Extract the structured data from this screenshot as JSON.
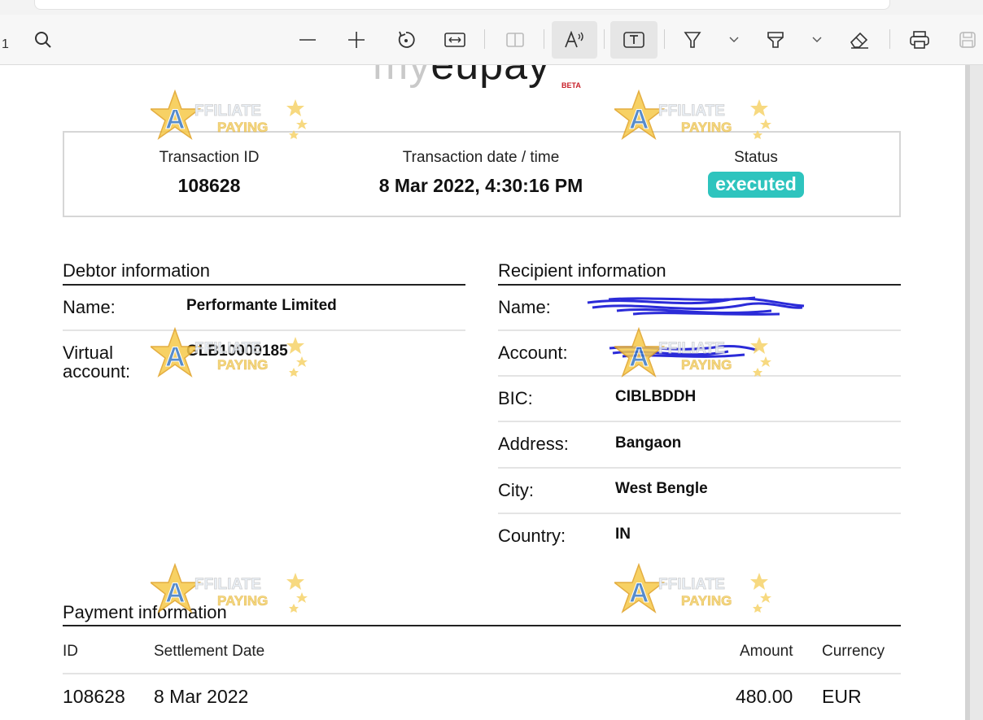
{
  "toolbar": {
    "page_number": "1",
    "icons": [
      "search-icon",
      "zoom-out-icon",
      "zoom-in-icon",
      "rotate-icon",
      "fit-width-icon",
      "two-page-icon",
      "read-aloud-icon",
      "text-box-icon",
      "draw-icon",
      "chevron-down-icon",
      "highlight-icon",
      "chevron-down-icon",
      "eraser-icon",
      "print-icon",
      "save-icon"
    ]
  },
  "logo": {
    "text_faded": "my",
    "text_main": "eupay",
    "beta": "BETA"
  },
  "summary": {
    "transaction_id_label": "Transaction ID",
    "transaction_id": "108628",
    "datetime_label": "Transaction date / time",
    "datetime": "8 Mar 2022, 4:30:16 PM",
    "status_label": "Status",
    "status": "executed",
    "status_color": "#2ec4be"
  },
  "debtor": {
    "title": "Debtor information",
    "name_label": "Name:",
    "name": "Performante Limited",
    "account_label_line1": "Virtual",
    "account_label_line2": "account:",
    "account": "GLB10000185"
  },
  "recipient": {
    "title": "Recipient information",
    "name_label": "Name:",
    "account_label": "Account:",
    "bic_label": "BIC:",
    "bic": "CIBLBDDH",
    "address_label": "Address:",
    "address": "Bangaon",
    "city_label": "City:",
    "city": "West Bengle",
    "country_label": "Country:",
    "country": "IN"
  },
  "payment": {
    "title": "Payment information",
    "headers": {
      "id": "ID",
      "settlement": "Settlement Date",
      "amount": "Amount",
      "currency": "Currency"
    },
    "row": {
      "id": "108628",
      "settlement": "8 Mar 2022",
      "amount": "480.00",
      "currency": "EUR"
    }
  },
  "watermark": {
    "line1": "AFFILIATE",
    "line2": "PAYING"
  }
}
